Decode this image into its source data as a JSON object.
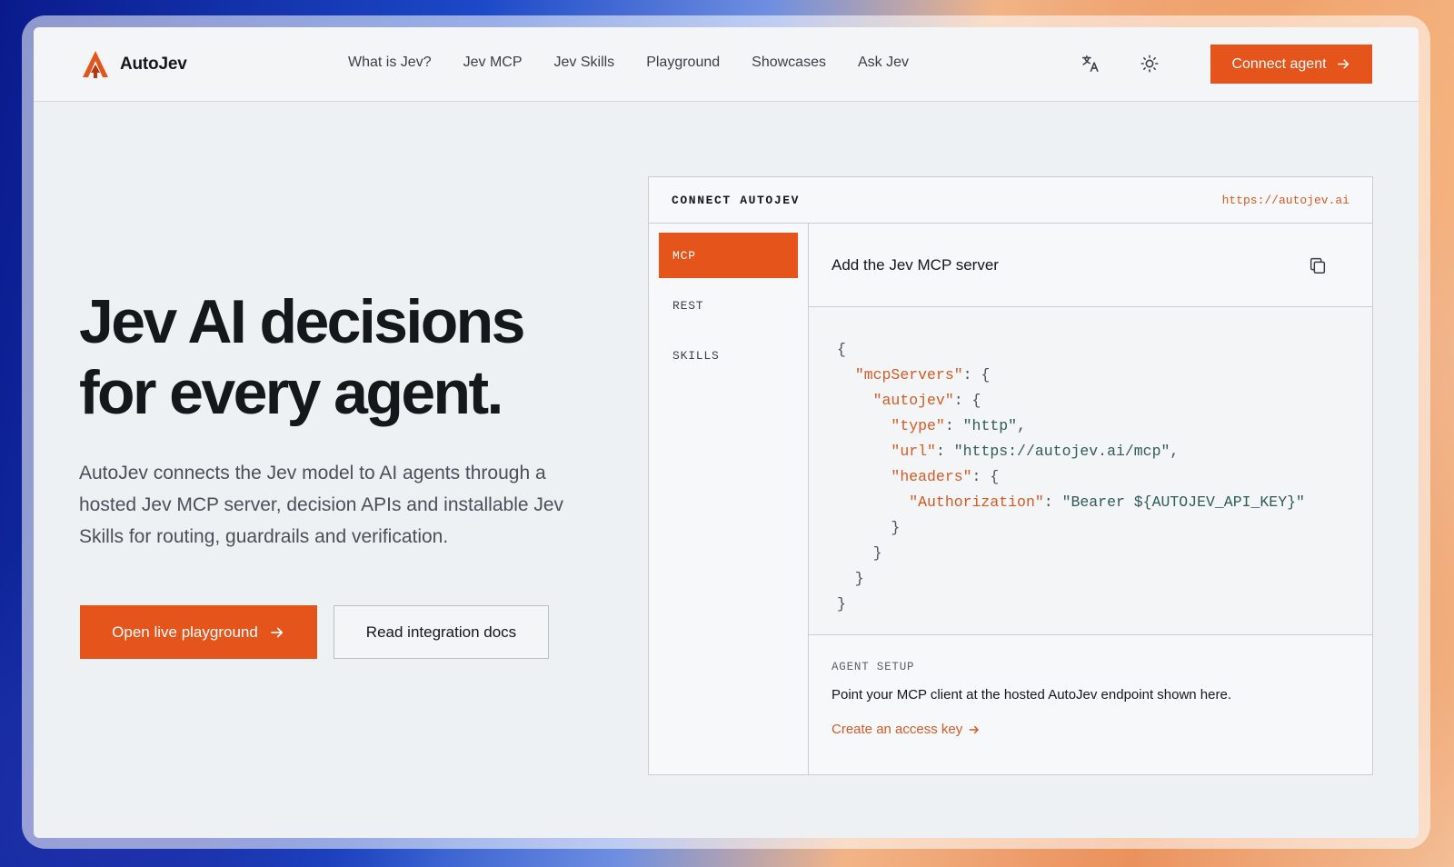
{
  "header": {
    "logo_text": "AutoJev",
    "nav": [
      "What is Jev?",
      "Jev MCP",
      "Jev Skills",
      "Playground",
      "Showcases",
      "Ask Jev"
    ],
    "icons": [
      "translate-icon",
      "sun-icon"
    ],
    "cta_label": "Connect agent"
  },
  "hero": {
    "title_line1": "Jev AI decisions",
    "title_line2": "for every agent.",
    "description": "AutoJev connects the Jev model to AI agents through a hosted Jev MCP server, decision APIs and installable Jev Skills for routing, guardrails and verification.",
    "primary_button": "Open live playground",
    "secondary_button": "Read integration docs"
  },
  "panel": {
    "title": "CONNECT AUTOJEV",
    "url": "https://autojev.ai",
    "tabs": [
      "MCP",
      "REST",
      "SKILLS"
    ],
    "active_tab": "MCP",
    "content_title": "Add the Jev MCP server",
    "code": {
      "open": "{",
      "k_mcpServers": "\"mcpServers\"",
      "k_autojev": "\"autojev\"",
      "k_type": "\"type\"",
      "v_type": "\"http\"",
      "k_url": "\"url\"",
      "v_url": "\"https://autojev.ai/mcp\"",
      "k_headers": "\"headers\"",
      "k_auth": "\"Authorization\"",
      "v_auth": "\"Bearer ${AUTOJEV_API_KEY}\""
    },
    "setup_label": "AGENT SETUP",
    "setup_text": "Point your MCP client at the hosted AutoJev endpoint shown here.",
    "setup_link": "Create an access key"
  },
  "colors": {
    "accent": "#e4541b",
    "code_key": "#d65a24",
    "code_string": "#2f5b5a"
  }
}
